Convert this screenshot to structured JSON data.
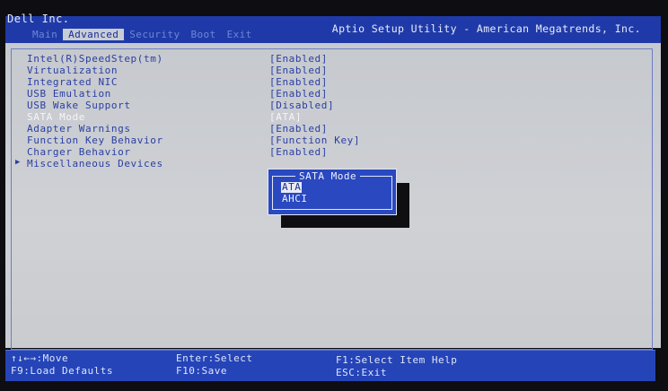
{
  "header": {
    "vendor": "Dell Inc.",
    "utility_title": "Aptio Setup Utility - American Megatrends, Inc.",
    "tabs": [
      {
        "label": "Main",
        "active": false
      },
      {
        "label": "Advanced",
        "active": true
      },
      {
        "label": "Security",
        "active": false
      },
      {
        "label": "Boot",
        "active": false
      },
      {
        "label": "Exit",
        "active": false
      }
    ]
  },
  "settings": [
    {
      "label": "Intel(R)SpeedStep(tm)",
      "value": "[Enabled]"
    },
    {
      "label": "Virtualization",
      "value": "[Enabled]"
    },
    {
      "label": "Integrated NIC",
      "value": "[Enabled]"
    },
    {
      "label": "USB Emulation",
      "value": "[Enabled]"
    },
    {
      "label": "USB Wake Support",
      "value": "[Disabled]"
    },
    {
      "label": "SATA Mode",
      "value": "[ATA]",
      "selected": true
    },
    {
      "label": "Adapter Warnings",
      "value": "[Enabled]"
    },
    {
      "label": "Function Key Behavior",
      "value": "[Function Key]"
    },
    {
      "label": "Charger Behavior",
      "value": "[Enabled]"
    },
    {
      "label": "Miscellaneous Devices",
      "value": "",
      "submenu": true
    }
  ],
  "popup": {
    "title": "SATA Mode",
    "options": [
      {
        "label": "ATA",
        "selected": true
      },
      {
        "label": "AHCI",
        "selected": false
      }
    ]
  },
  "footer": {
    "move": "↑↓←→:Move",
    "load_defaults": "F9:Load Defaults",
    "enter_select": "Enter:Select",
    "f10_save": "F10:Save",
    "f1_help": "F1:Select Item Help",
    "esc_exit": "ESC:Exit"
  },
  "colors": {
    "header_blue": "#1f3aa8",
    "panel_grey": "#c8cbd0",
    "text_blue": "#2a3fa3",
    "popup_blue": "#2a48c0"
  }
}
